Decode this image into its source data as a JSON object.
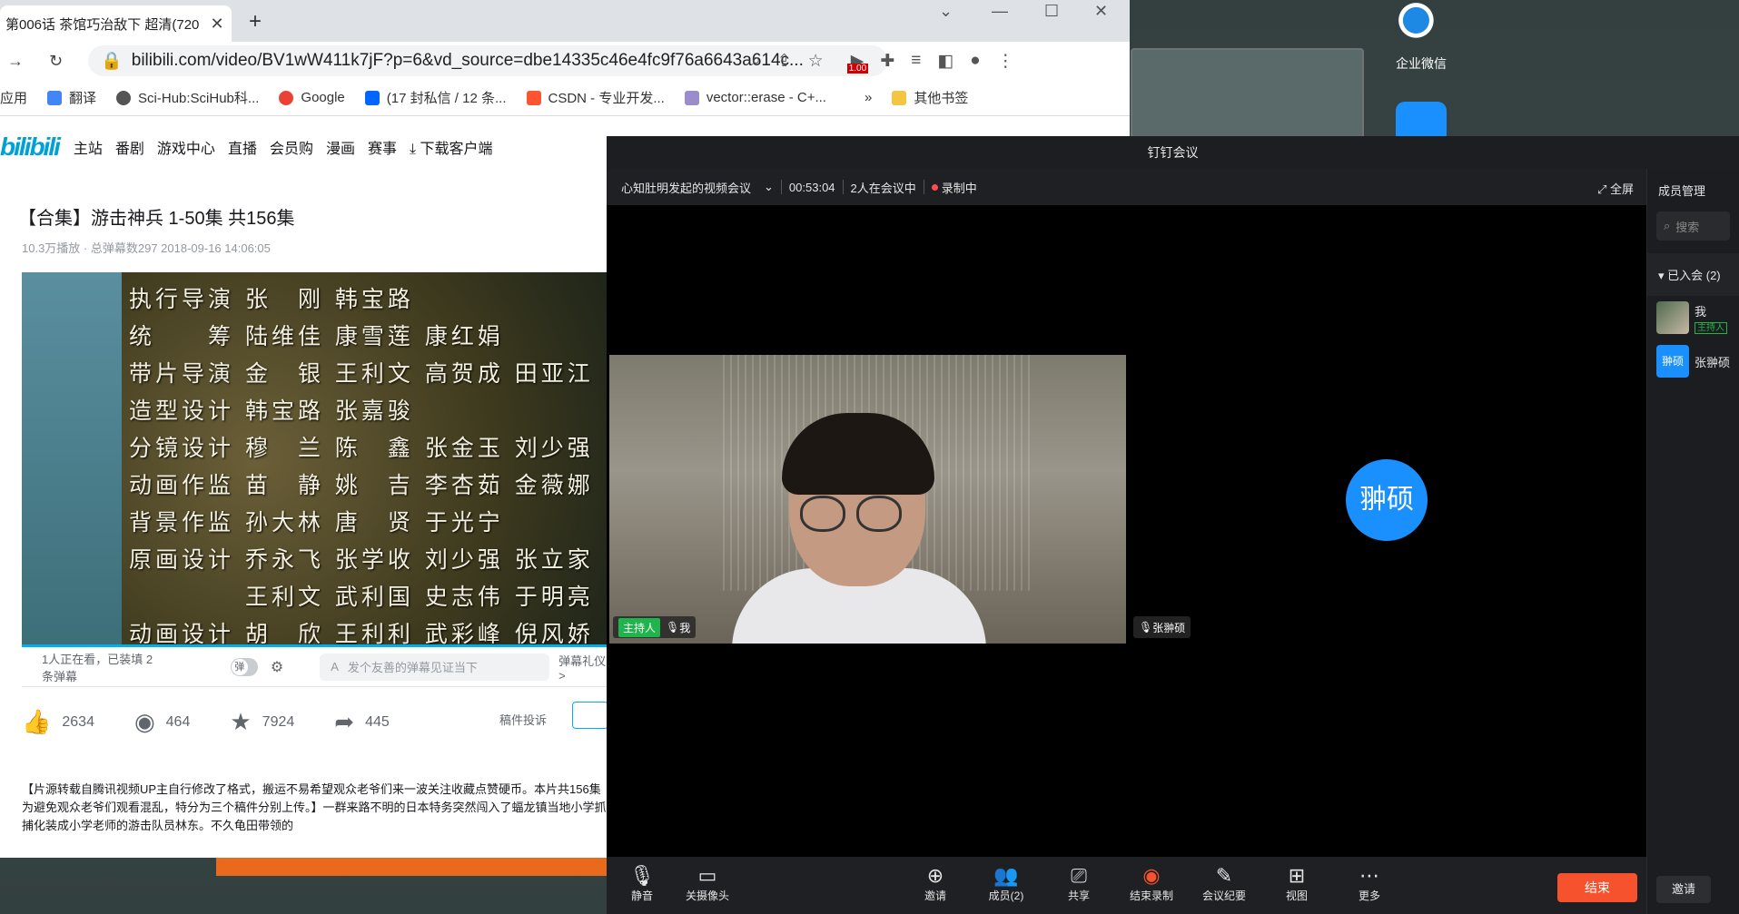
{
  "desktop": {
    "icons": [
      {
        "label": "企业微信"
      }
    ]
  },
  "browser": {
    "tab_title": "第006话 茶馆巧治敌下 超清(720",
    "url": "bilibili.com/video/BV1wW411k7jF?p=6&vd_source=dbe14335c46e4fc9f76a6643a614c...",
    "ext_badge": "1.00",
    "bookmarks": [
      "应用",
      "翻译",
      "Sci-Hub:SciHub科...",
      "Google",
      "(17 封私信 / 12 条...",
      "CSDN - 专业开发...",
      "vector::erase - C+...",
      "»",
      "其他书签"
    ]
  },
  "bili": {
    "nav": [
      "主站",
      "番剧",
      "游戏中心",
      "直播",
      "会员购",
      "漫画",
      "赛事",
      "下载客户端"
    ],
    "title": "【合集】游击神兵 1-50集 共156集",
    "meta": "10.3万播放 · 总弹幕数297   2018-09-16 14:06:05",
    "credits": [
      "执行导演  张　刚  韩宝路",
      "统　　筹  陆维佳  康雪莲  康红娟",
      "带片导演  金　银  王利文  高贺成  田亚江",
      "造型设计  韩宝路  张嘉骏",
      "分镜设计  穆　兰  陈　鑫  张金玉  刘少强",
      "动画作监  苗　静  姚　吉  李杏茹  金薇娜",
      "背景作监  孙大林  唐　贤  于光宁",
      "原画设计  乔永飞  张学收  刘少强  张立家",
      "　　　　  王利文  武利国  史志伟  于明亮",
      "动画设计  胡　欣  王利利  武彩峰  倪风娇"
    ],
    "watching": "1人正在看，已装填 2 条弹幕",
    "danmu_placeholder": "发个友善的弹幕见证当下",
    "danmu_etiquette": "弹幕礼仪 >",
    "likes": "2634",
    "coins": "464",
    "favorites": "7924",
    "shares": "445",
    "report": "稿件投诉",
    "desc": "【片源转载自腾讯视频UP主自行修改了格式，搬运不易希望观众老爷们来一波关注收藏点赞硬币。本片共156集为避免观众老爷们观看混乱，特分为三个稿件分别上传。】一群来路不明的日本特务突然闯入了蝠龙镇当地小学抓捕化装成小学老师的游击队员林东。不久龟田带领的"
  },
  "meeting": {
    "window_title": "钉钉会议",
    "meeting_name": "心知肚明发起的视频会议",
    "duration": "00:53:04",
    "participants_status": "2人在会议中",
    "recording": "录制中",
    "fullscreen": "全屏",
    "host_tag": "主持人",
    "self_label": "我",
    "remote_label": "张翀硕",
    "remote_avatar": "翀硕",
    "toolbar": [
      "静音",
      "关摄像头",
      "邀请",
      "成员(2)",
      "共享",
      "结束录制",
      "会议纪要",
      "视图",
      "更多"
    ],
    "end_label": "结束",
    "side": {
      "header": "成员管理",
      "search": "搜索",
      "group": "已入会 (2)",
      "members": [
        {
          "name": "我",
          "role": "主持人"
        },
        {
          "name": "张翀硕",
          "avatar": "翀硕"
        }
      ],
      "invite": "邀请"
    }
  }
}
